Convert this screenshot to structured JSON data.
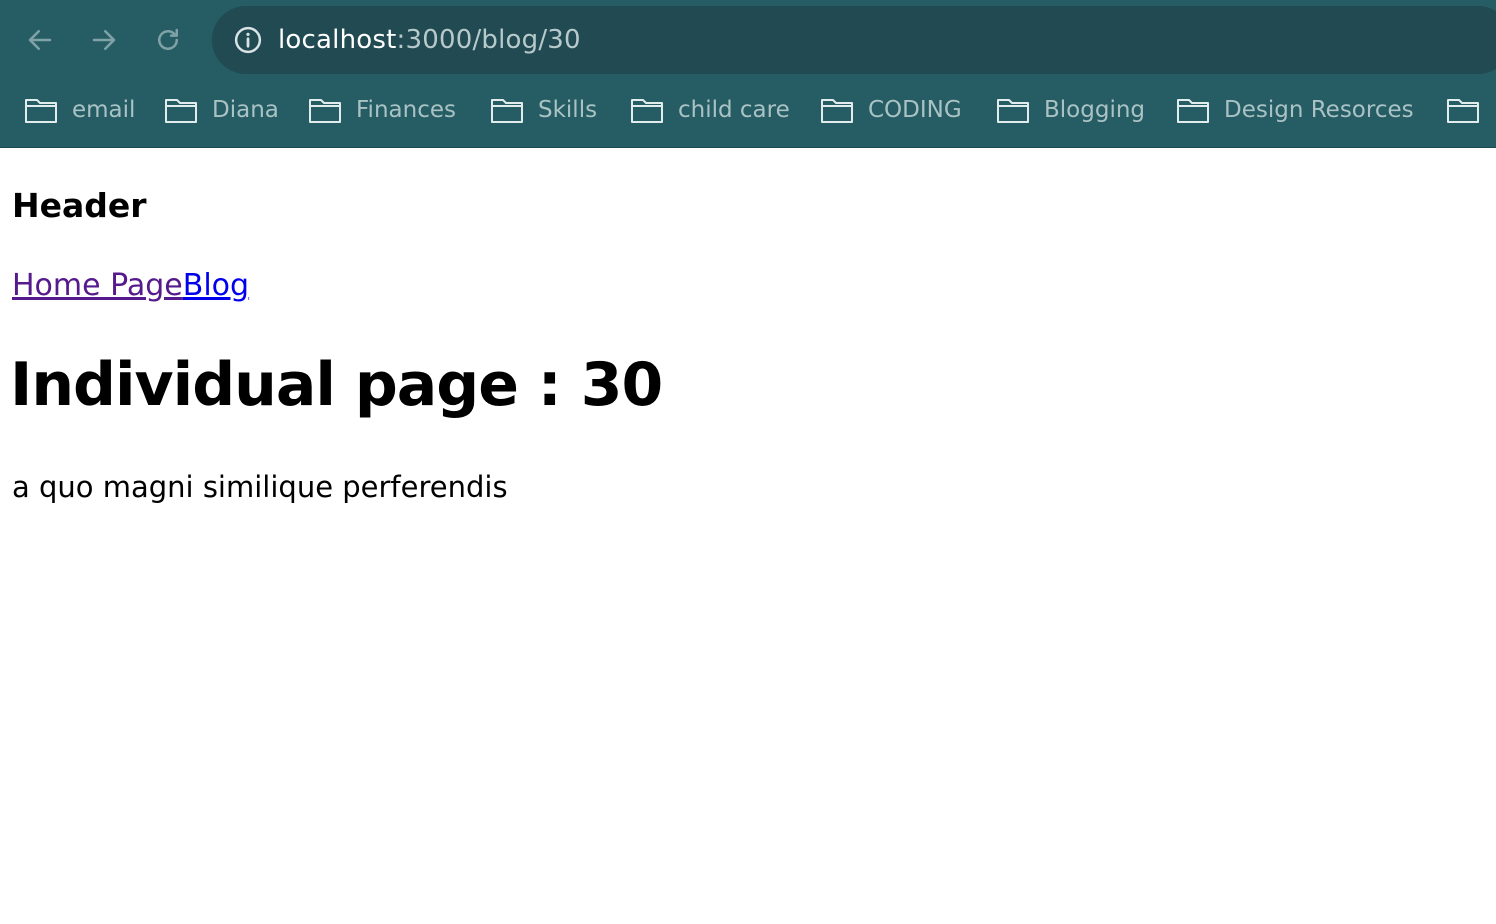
{
  "browser": {
    "url_host": "localhost",
    "url_path": ":3000/blog/30",
    "bookmarks": [
      {
        "label": "email"
      },
      {
        "label": "Diana"
      },
      {
        "label": "Finances"
      },
      {
        "label": "Skills"
      },
      {
        "label": "child care"
      },
      {
        "label": "CODING"
      },
      {
        "label": "Blogging"
      },
      {
        "label": "Design Resorces"
      },
      {
        "label": ""
      }
    ]
  },
  "page": {
    "header_title": "Header",
    "nav": {
      "home_label": "Home Page",
      "blog_label": "Blog"
    },
    "heading": "Individual page : 30",
    "body_text": "a quo magni similique perferendis"
  },
  "colors": {
    "chrome_bg": "#265c63",
    "address_bg": "#214a52",
    "link_visited": "#551a8b",
    "link": "#0000ee"
  },
  "icons": {
    "back": "arrow-left-icon",
    "forward": "arrow-right-icon",
    "reload": "reload-icon",
    "site_info": "info-icon",
    "bookmark_folder": "folder-icon"
  }
}
